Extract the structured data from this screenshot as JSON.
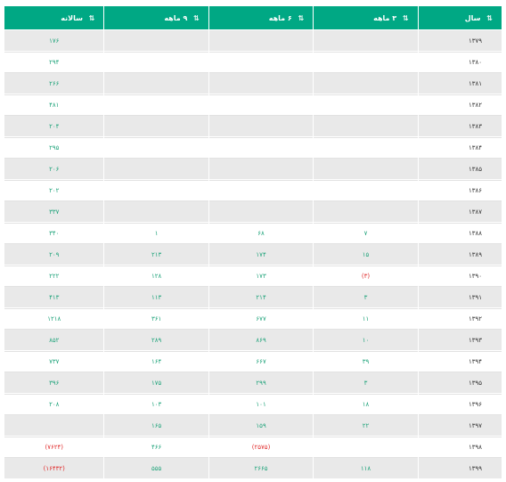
{
  "columns": {
    "year": "سال",
    "q3": "۳ ماهه",
    "q6": "۶ ماهه",
    "q9": "۹ ماهه",
    "annual": "سالانه"
  },
  "rows": [
    {
      "year": "۱۳۷۹",
      "q3": "",
      "q6": "",
      "q9": "",
      "annual": "۱۷۶"
    },
    {
      "year": "۱۳۸۰",
      "q3": "",
      "q6": "",
      "q9": "",
      "annual": "۲۹۴"
    },
    {
      "year": "۱۳۸۱",
      "q3": "",
      "q6": "",
      "q9": "",
      "annual": "۲۶۶"
    },
    {
      "year": "۱۳۸۲",
      "q3": "",
      "q6": "",
      "q9": "",
      "annual": "۴۸۱"
    },
    {
      "year": "۱۳۸۳",
      "q3": "",
      "q6": "",
      "q9": "",
      "annual": "۲۰۴"
    },
    {
      "year": "۱۳۸۴",
      "q3": "",
      "q6": "",
      "q9": "",
      "annual": "۲۹۵"
    },
    {
      "year": "۱۳۸۵",
      "q3": "",
      "q6": "",
      "q9": "",
      "annual": "۲۰۶"
    },
    {
      "year": "۱۳۸۶",
      "q3": "",
      "q6": "",
      "q9": "",
      "annual": "۲۰۲"
    },
    {
      "year": "۱۳۸۷",
      "q3": "",
      "q6": "",
      "q9": "",
      "annual": "۳۳۷"
    },
    {
      "year": "۱۳۸۸",
      "q3": "۷",
      "q6": "۶۸",
      "q9": "۱",
      "annual": "۳۴۰"
    },
    {
      "year": "۱۳۸۹",
      "q3": "۱۵",
      "q6": "۱۷۴",
      "q9": "۲۱۳",
      "annual": "۲۰۹"
    },
    {
      "year": "۱۳۹۰",
      "q3": "(۳)",
      "q6": "۱۷۳",
      "q9": "۱۲۸",
      "annual": "۲۲۲"
    },
    {
      "year": "۱۳۹۱",
      "q3": "۳",
      "q6": "۲۱۴",
      "q9": "۱۱۳",
      "annual": "۴۱۳"
    },
    {
      "year": "۱۳۹۲",
      "q3": "۱۱",
      "q6": "۶۷۷",
      "q9": "۳۶۱",
      "annual": "۱۲۱۸"
    },
    {
      "year": "۱۳۹۳",
      "q3": "۱۰",
      "q6": "۸۶۹",
      "q9": "۲۸۹",
      "annual": "۸۵۲"
    },
    {
      "year": "۱۳۹۴",
      "q3": "۳۹",
      "q6": "۶۶۷",
      "q9": "۱۶۴",
      "annual": "۷۳۷"
    },
    {
      "year": "۱۳۹۵",
      "q3": "۳",
      "q6": "۲۹۹",
      "q9": "۱۷۵",
      "annual": "۳۹۶"
    },
    {
      "year": "۱۳۹۶",
      "q3": "۱۸",
      "q6": "۱۰۱",
      "q9": "۱۰۳",
      "annual": "۲۰۸"
    },
    {
      "year": "۱۳۹۷",
      "q3": "۲۲",
      "q6": "۱۵۹",
      "q9": "۱۶۵",
      "annual": ""
    },
    {
      "year": "۱۳۹۸",
      "q3": "",
      "q6": "(۲۵۷۵)",
      "q9": "۴۶۶",
      "annual": "(۷۶۲۴)"
    },
    {
      "year": "۱۳۹۹",
      "q3": "۱۱۸",
      "q6": "۲۶۶۵",
      "q9": "۵۵۵",
      "annual": "(۱۶۴۳۲)"
    }
  ],
  "colors": {
    "header_bg": "#00a884",
    "positive": "#1fa37a",
    "negative": "#e02b2b",
    "row_alt": "#e9e9e9"
  }
}
